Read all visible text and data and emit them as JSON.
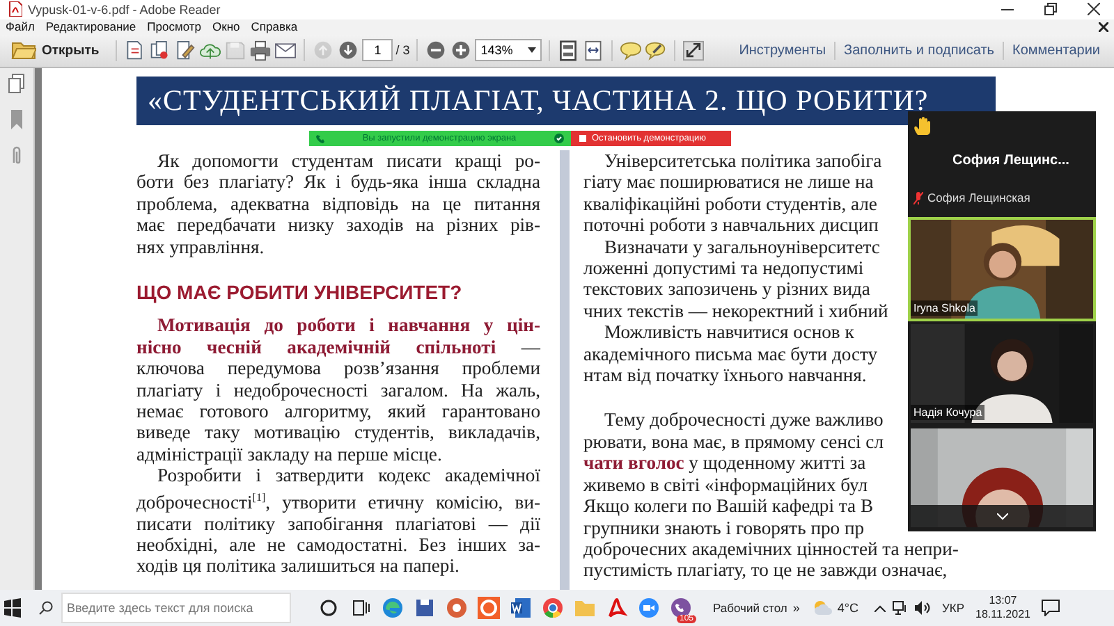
{
  "window": {
    "title": "Vypusk-01-v-6.pdf - Adobe Reader"
  },
  "menu": [
    "Файл",
    "Редактирование",
    "Просмотр",
    "Окно",
    "Справка"
  ],
  "toolbar": {
    "open": "Открыть",
    "groups": [
      [
        {
          "kind": "create",
          "disabled": false
        },
        {
          "kind": "combine",
          "disabled": false
        },
        {
          "kind": "edit",
          "disabled": false
        },
        {
          "kind": "upload",
          "disabled": false
        },
        {
          "kind": "save",
          "disabled": true
        },
        {
          "kind": "print",
          "disabled": false
        },
        {
          "kind": "mail",
          "disabled": false
        }
      ],
      [
        {
          "kind": "prev",
          "disabled": true
        },
        {
          "kind": "next",
          "disabled": false
        },
        {
          "kind": "page",
          "value": "1",
          "total": "/ 3"
        }
      ],
      [
        {
          "kind": "minus",
          "disabled": false
        },
        {
          "kind": "plus",
          "disabled": false
        },
        {
          "kind": "zoom",
          "value": "143%"
        }
      ],
      [
        {
          "kind": "fit-page",
          "disabled": false
        },
        {
          "kind": "fit-width",
          "disabled": false
        }
      ],
      [
        {
          "kind": "comment",
          "disabled": false
        },
        {
          "kind": "sticky",
          "disabled": false
        }
      ],
      [
        {
          "kind": "fullscreen",
          "disabled": false
        }
      ]
    ],
    "panels": [
      "Инструменты",
      "Заполнить и подписать",
      "Комментарии"
    ]
  },
  "document": {
    "title": "«СТУДЕНТСЬКИЙ ПЛАГІАТ, ЧАСТИНА 2. ЩО РОБИТИ?",
    "left_column": [
      {
        "kind": "paragraph",
        "lines": [
          "Як допомогти студентам писати кращі ро-",
          "боти без плагіату? Як і будь-яка інша складна",
          "проблема, адекватна відповідь на це питання",
          "має передбачати низку заходів на різних рів-",
          "нях управління."
        ]
      },
      {
        "kind": "heading",
        "text": "ЩО МАЄ РОБИТИ УНІВЕРСИТЕТ?"
      },
      {
        "kind": "paragraph",
        "lines": [
          "**Мотивація до роботи і навчання у цін-**",
          "**нісно чесній академічній спільноті** —",
          "ключова передумова розв’язання проблеми",
          "плагіату і недоброчесності загалом. На жаль,",
          "немає готового алгоритму, який гарантовано",
          "виведе таку мотивацію студентів, викладачів,",
          "адміністрації закладу на перше місце."
        ]
      },
      {
        "kind": "paragraph",
        "lines": [
          "Розробити і затвердити кодекс академічної",
          "доброчесності$^{[1]}$, утворити етичну комісію, ви-",
          "писати політику запобігання плагіатові — дії",
          "необхідні, але не самодостатні. Без інших за-",
          "ходів ця політика залишиться на папері."
        ]
      }
    ],
    "right_column": [
      {
        "kind": "paragraph",
        "lines": [
          "Університетська політика запобіга",
          "гіату має поширюватися не лише на",
          "кваліфікаційні роботи студентів, але",
          "поточні роботи з навчальних дисцип"
        ]
      },
      {
        "kind": "paragraph",
        "lines": [
          "Визначати у загальноуніверситетс",
          "ложенні допустимі та недопустимі",
          "текстових запозичень у різних вида",
          "чних текстів — некоректний і хибний"
        ]
      },
      {
        "kind": "paragraph",
        "lines": [
          "Можливість навчитися основ к",
          "академічного письма має бути досту",
          "нтам від початку їхнього навчання."
        ]
      },
      {
        "kind": "break"
      },
      {
        "kind": "paragraph",
        "lines": [
          "Тему доброчесності дуже важливо",
          "рювати, вона має, в прямому сенсі сл",
          "**чати вголос** у щоденному житті за",
          "живемо в світі «інформаційних бул",
          "Якщо колеги по Вашій кафедрі та В",
          "групники знають і говорять про пр",
          "доброчесних академічних цінностей та непри-",
          "пустимість плагіату, то це не завжди означає,"
        ]
      }
    ]
  },
  "screen_share": {
    "status": "Вы запустили демонстрацию экрана",
    "stop_button": "Остановить демонстрацию"
  },
  "meeting": {
    "title": "София Лещинс...",
    "speaker": "София Лещинская",
    "videos": [
      {
        "name": "Iryna Shkola",
        "selected": true
      },
      {
        "name": "Надія Кочура",
        "selected": false
      },
      {
        "selected": false
      }
    ]
  },
  "taskbar": {
    "search": {
      "placeholder": "Введите здесь текст для поиска"
    },
    "badge": "105",
    "desktop": "Рабочий стол",
    "more": "»",
    "temperature": "4°C",
    "language": "УКР",
    "time": "13:07",
    "date": "18.11.2021"
  }
}
